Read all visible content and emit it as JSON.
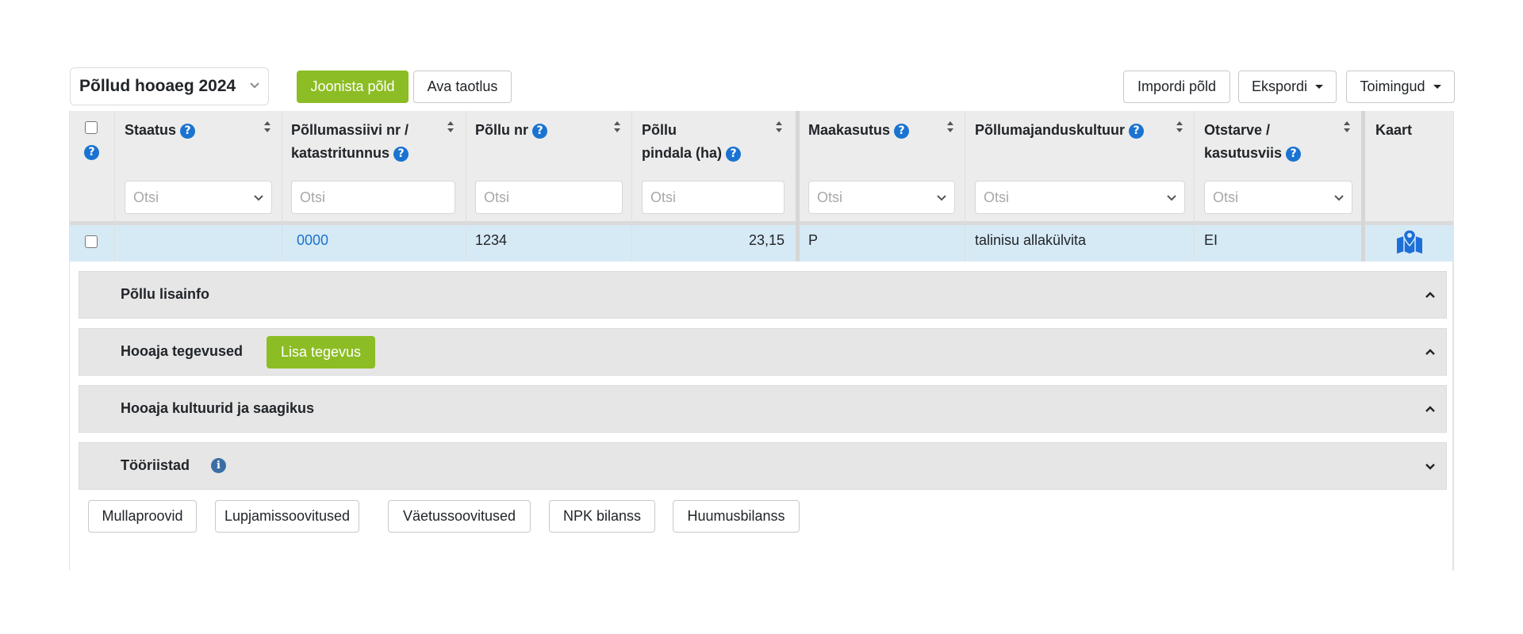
{
  "toolbar": {
    "season_select": "Põllud hooaeg 2024",
    "draw_field": "Joonista põld",
    "open_application": "Ava taotlus",
    "import_field": "Impordi põld",
    "export": "Ekspordi",
    "actions": "Toimingud"
  },
  "table": {
    "columns": [
      {
        "line1": "Staatus",
        "line2": ""
      },
      {
        "line1": "Põllumassiivi nr /",
        "line2": "katastritunnus"
      },
      {
        "line1": "Põllu nr",
        "line2": ""
      },
      {
        "line1": "Põllu",
        "line2": "pindala (ha)"
      },
      {
        "line1": "Maakasutus",
        "line2": ""
      },
      {
        "line1": "Põllumajanduskultuur",
        "line2": ""
      },
      {
        "line1": "Otstarve /",
        "line2": "kasutusviis"
      },
      {
        "line1": "Kaart",
        "line2": ""
      }
    ],
    "filter_placeholder": "Otsi",
    "row": {
      "status": "",
      "block_nr": "0000",
      "field_nr": "1234",
      "area": "23,15",
      "land_use": "P",
      "crop": "talinisu allakülvita",
      "purpose": "EI"
    }
  },
  "panels": {
    "extra_info": "Põllu lisainfo",
    "season_activities": "Hooaja tegevused",
    "add_activity": "Lisa tegevus",
    "season_crops": "Hooaja kultuurid ja saagikus",
    "tools": "Tööriistad"
  },
  "tools": [
    "Mullaproovid",
    "Lupjamissoovitused",
    "Väetussoovitused",
    "NPK bilanss",
    "Huumusbilanss"
  ],
  "colors": {
    "accent_green": "#8cbd24",
    "link_blue": "#1a73d1",
    "row_selected": "#d6eaf5",
    "panel_bg": "#e6e6e6"
  },
  "icons": [
    "chevron-down-icon",
    "help-icon",
    "sort-icon",
    "map-marker-icon",
    "chevron-up-icon",
    "info-icon"
  ]
}
